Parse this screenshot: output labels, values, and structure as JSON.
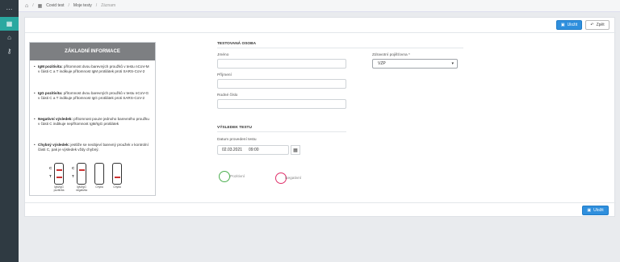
{
  "sidebar": {
    "items": [
      {
        "icon": "menu-icon"
      },
      {
        "icon": "calendar-icon"
      },
      {
        "icon": "home-icon"
      },
      {
        "icon": "key-icon"
      }
    ]
  },
  "breadcrumb": {
    "home": "home-icon",
    "items": [
      "Covid test",
      "Moje testy",
      "Záznam"
    ]
  },
  "toolbar": {
    "save_label": "Uložit",
    "back_label": "Zpět"
  },
  "info": {
    "title": "ZÁKLADNÍ INFORMACE",
    "igm": {
      "label": "IgM pozitivita:",
      "text": " přítomnost dvou barevných proužků v testu nCoV-M v části C a T indikuje přítomnost IgM protilátek proti SARS-CoV-2"
    },
    "igg": {
      "label": "IgG pozitivita:",
      "text": " přítomnost dvou barevných proužků v testu nCoV-G v části C a T indikuje přítomnost IgG protilátek proti SARS-CoV-2"
    },
    "neg": {
      "label": "Negativní výsledek:",
      "text": " přítomnost pouze jednoho barevného proužku v části C indikuje nepřítomnost IgM/IgG protilátek"
    },
    "err": {
      "label": "Chybný výsledek:",
      "text": " jestliže se neobjeví barevný proužek v kontrolní části C, pak je výsledek vždy chybný."
    },
    "kits": [
      "IgM/IgG pozitivita",
      "IgM/IgG negativita",
      "Chyba",
      "Chyba"
    ]
  },
  "person": {
    "section": "TESTOVANÁ OSOBA",
    "first_name_label": "Jméno",
    "first_name": "",
    "last_name_label": "Příjmení",
    "last_name": "",
    "birth_no_label": "Rodné číslo",
    "birth_no": "",
    "insurance_label": "Zdravotní pojišťovna *",
    "insurance": "VZP"
  },
  "result": {
    "section": "VÝSLEDEK TESTU",
    "date_label": "Datum provedení testu",
    "date": "02.03.2021",
    "time": "09:00",
    "positive": "Pozitivní",
    "negative": "Negativní"
  },
  "colors": {
    "accent": "#2f8fdd",
    "sidebar": "#2f3a42",
    "active": "#2aa8a0",
    "positive": "#4caf50",
    "negative": "#e0306a"
  }
}
